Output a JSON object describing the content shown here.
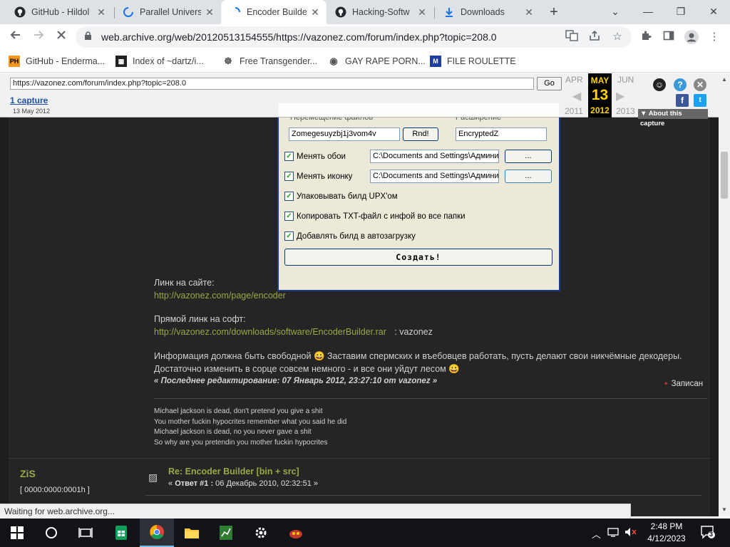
{
  "tabs": [
    {
      "title": "GitHub - Hildol",
      "icon": "github-icon"
    },
    {
      "title": "Parallel Univers",
      "icon": "loading-icon"
    },
    {
      "title": "Encoder Builde",
      "icon": "loading-icon"
    },
    {
      "title": "Hacking-Softw",
      "icon": "github-icon"
    },
    {
      "title": "Downloads",
      "icon": "download-icon"
    }
  ],
  "window_controls": {
    "minimize": "—",
    "maximize": "❐",
    "close": "✕",
    "tab_list": "⌄",
    "new_tab": "+"
  },
  "address_bar": {
    "url": "web.archive.org/web/20120513154555/https://vazonez.com/forum/index.php?topic=208.0"
  },
  "bookmarks": [
    {
      "label": "GitHub - Enderma...",
      "icon_text": "PH"
    },
    {
      "label": "Index of ~dartz/i...",
      "icon_text": "▦"
    },
    {
      "label": "Free Transgender...",
      "icon_text": "☸"
    },
    {
      "label": "GAY RAPE PORN...",
      "icon_text": "◉"
    },
    {
      "label": "FILE ROULETTE",
      "icon_text": "M"
    }
  ],
  "wayback": {
    "url_value": "https://vazonez.com/forum/index.php?topic=208.0",
    "go_label": "Go",
    "captures_link": "1 capture",
    "capture_date": "13 May 2012",
    "prev_month": "APR",
    "cur_month": "MAY",
    "next_month": "JUN",
    "cur_day": "13",
    "prev_year": "2011",
    "cur_year": "2012",
    "next_year": "2013",
    "about_label": "▼ About this capture"
  },
  "dialog": {
    "hidden_label_1": "Перемещение файлов",
    "hidden_label_2": "Расширение",
    "hidden_field_1": "Zomegesuyzbj1j3vom4v",
    "hidden_btn": "Rnd!",
    "hidden_field_2": "EncryptedZ",
    "rows": [
      {
        "label": "Менять обои",
        "field": "C:\\Documents and Settings\\Админи",
        "button": "..."
      },
      {
        "label": "Менять иконку",
        "field": "C:\\Documents and Settings\\Админи",
        "button": "..."
      },
      {
        "label": "Упаковывать билд UPX'ом"
      },
      {
        "label": "Копировать TXT-файл с инфой во все папки"
      },
      {
        "label": "Добавлять билд в автозагрузку"
      }
    ],
    "check_mark": "✓",
    "create_button": "Создать!"
  },
  "post": {
    "site_link_label": "Линк на сайте:",
    "site_link": "http://vazonez.com/page/encoder",
    "direct_link_label": "Прямой линк на софт:",
    "direct_link": "http://vazonez.com/downloads/software/EncoderBuilder.rar",
    "direct_link_suffix": ":   vazonez",
    "info_line_1": "Информация должна быть свободной 😀 Заставим спермских и въебовцев работать, пусть делают свои никчёмные декодеры.",
    "info_line_2": "Достаточно изменить в сорце совсем немного - и все они уйдут лесом 😀",
    "edit_note": "« Последнее редактирование: 07 Январь 2012, 23:27:10 от vazonez »",
    "saved_label": "Записан"
  },
  "signature": [
    "Michael jackson is dead, don't pretend you give a shit",
    "You mother fuckin hypocrites remember what you said he did",
    "Michael jackson is dead, no you never gave a shit",
    "So why are you pretendin you mother fuckin hypocrites"
  ],
  "next_post": {
    "author": "ZiS",
    "author_id": "[ 0000:0000:0001h ]",
    "title": "Re: Encoder Builder [bin + src]",
    "meta_prefix": "« ",
    "meta_strong": "Ответ #1 :",
    "meta_rest": " 06 Декабрь 2010, 02:32:51 »"
  },
  "status_text": "Waiting for web.archive.org...",
  "taskbar": {
    "time": "2:48 PM",
    "date": "4/12/2023",
    "notification_count": "3"
  },
  "colors": {
    "page_bg": "#1e1e1e",
    "post_bg": "#252525",
    "link": "#9aa845",
    "wayback_highlight": "#ffd200",
    "taskbar": "#111318"
  }
}
